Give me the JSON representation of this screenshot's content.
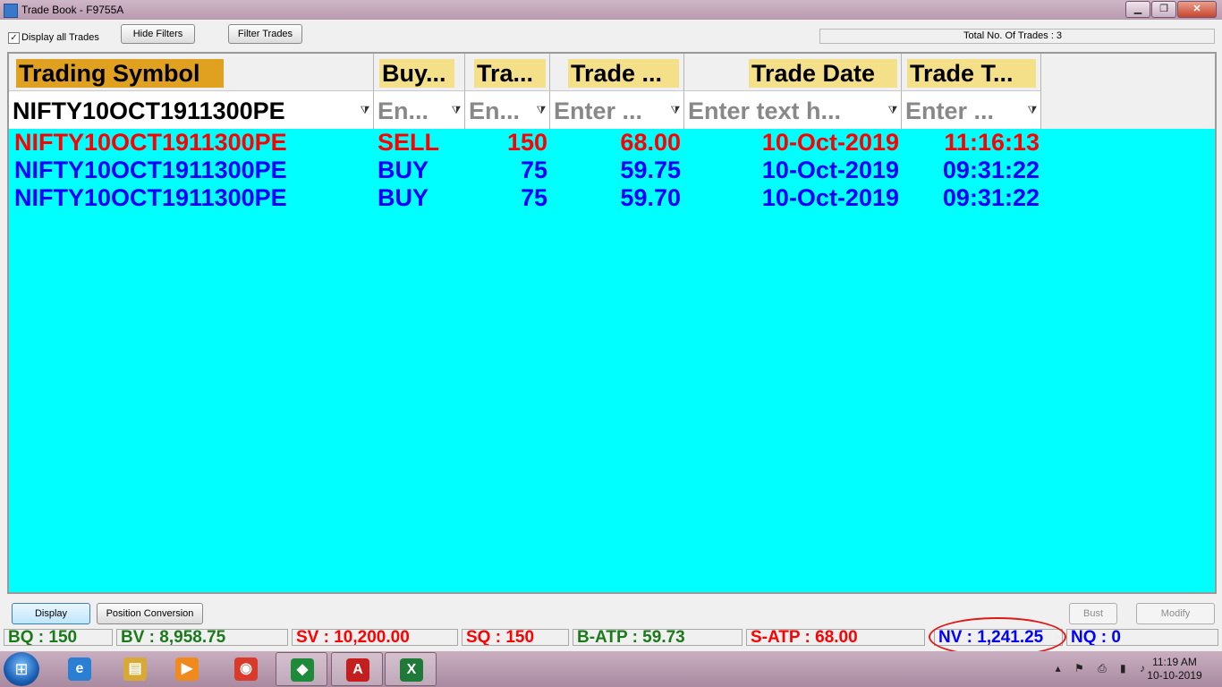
{
  "window": {
    "title": "Trade Book - F9755A",
    "minimize_glyph": "▁",
    "maximize_glyph": "❐",
    "close_glyph": "✕"
  },
  "toolbar": {
    "display_all_label": "Display all Trades",
    "display_all_checked": true,
    "check_glyph": "✓",
    "hide_filters_label": "Hide Filters",
    "filter_trades_label": "Filter Trades",
    "total_trades_text": "Total No. Of Trades : 3"
  },
  "grid": {
    "columns": [
      {
        "label": "Trading Symbol",
        "filter_text": "NIFTY10OCT1911300PE",
        "filter_is_value": true
      },
      {
        "label": "Buy...",
        "filter_text": "En...",
        "filter_is_value": false
      },
      {
        "label": "Tra...",
        "filter_text": "En...",
        "filter_is_value": false
      },
      {
        "label": "Trade ...",
        "filter_text": "Enter ...",
        "filter_is_value": false
      },
      {
        "label": "Trade Date",
        "filter_text": "Enter text h...",
        "filter_is_value": false
      },
      {
        "label": "Trade T...",
        "filter_text": "Enter ...",
        "filter_is_value": false
      }
    ],
    "funnel_glyph": "⧩",
    "rows": [
      {
        "symbol": "NIFTY10OCT1911300PE",
        "side": "SELL",
        "qty": "150",
        "price": "68.00",
        "date": "10-Oct-2019",
        "time": "11:16:13",
        "color": "#ff0000"
      },
      {
        "symbol": "NIFTY10OCT1911300PE",
        "side": "BUY",
        "qty": "75",
        "price": "59.75",
        "date": "10-Oct-2019",
        "time": "09:31:22",
        "color": "#0000ff"
      },
      {
        "symbol": "NIFTY10OCT1911300PE",
        "side": "BUY",
        "qty": "75",
        "price": "59.70",
        "date": "10-Oct-2019",
        "time": "09:31:22",
        "color": "#0000ff"
      }
    ],
    "background_color": "#00ffff",
    "header_highlight_color": "#f5e08a",
    "first_header_highlight_color": "#e0a020"
  },
  "bottom_buttons": {
    "display_label": "Display",
    "position_conversion_label": "Position Conversion",
    "bust_label": "Bust",
    "modify_label": "Modify"
  },
  "status": {
    "bq": "BQ : 150",
    "bv": "BV : 8,958.75",
    "sv": "SV : 10,200.00",
    "sq": "SQ : 150",
    "batp": "B-ATP : 59.73",
    "satp": "S-ATP : 68.00",
    "nv": "NV : 1,241.25",
    "nq": "NQ : 0",
    "colors": {
      "buy": "#1a7a1a",
      "sell": "#ff0000",
      "net": "#0000ff"
    }
  },
  "taskbar": {
    "start_glyph": "⊞",
    "items": [
      {
        "name": "ie-icon",
        "glyph": "e",
        "color": "#2a7fd4"
      },
      {
        "name": "explorer-icon",
        "glyph": "▤",
        "color": "#d9a935"
      },
      {
        "name": "media-player-icon",
        "glyph": "▶",
        "color": "#f08a1c"
      },
      {
        "name": "chrome-icon",
        "glyph": "◉",
        "color": "#d93a2a"
      },
      {
        "name": "trading-app-icon",
        "glyph": "◆",
        "color": "#1e8a3a"
      },
      {
        "name": "acrobat-icon",
        "glyph": "A",
        "color": "#c41e1e"
      },
      {
        "name": "excel-icon",
        "glyph": "X",
        "color": "#1f7a3a"
      }
    ],
    "tray_glyphs": "▴ ⚑ ⎙ ▮ ♪",
    "time": "11:19 AM",
    "date": "10-10-2019"
  }
}
